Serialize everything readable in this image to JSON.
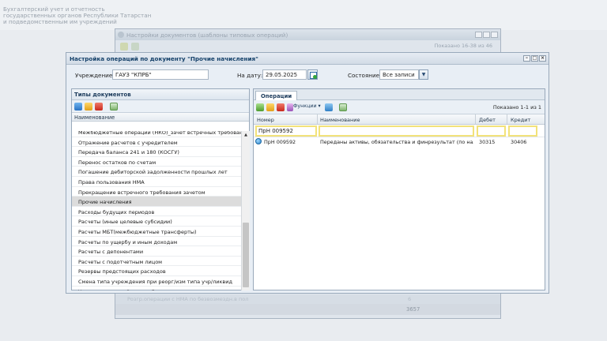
{
  "app": {
    "org_name": "Бухгалтерский учет и отчетность\nгосударственных органов Республики Татарстан\nи подведомственным им учреждений"
  },
  "background_window": {
    "title": "Настройки документов (шаблоны типовых операций)",
    "shown": "Показано 16-38 из 46",
    "footer_row_text": "Розгр.операции с НМА по безвозмездн.в пол",
    "footer_row_num": "6",
    "total": "3657"
  },
  "dialog": {
    "title": "Настройка операций по документу \"Прочие начисления\"",
    "institution_label": "Учреждение:",
    "institution_value": "ГАУЗ \"КПРБ\"",
    "date_label": "На дату:",
    "date_value": "29.05.2025",
    "state_label": "Состояние:",
    "state_value": "Все записи"
  },
  "left_panel": {
    "title": "Типы документов",
    "column_header": "Наименование",
    "items": [
      "Межбюджетные операции (НКО)_зачет встречных требований",
      "Отражение расчетов с учредителем",
      "Передача баланса 241 и 180 (КОСГУ)",
      "Перенос остатков по счетам",
      "Погашение дебиторской задолженности прошлых лет",
      "Права пользования НМА",
      "Прекращение встречного требования зачетом",
      "Прочие начисления",
      "Расходы будущих периодов",
      "Расчеты (иные целевые субсидии)",
      "Расчеты МБТ(межбюджетные трансферты)",
      "Расчеты по ущербу и иным доходам",
      "Расчеты с депонентами",
      "Расчеты с подотчетным лицом",
      "Резервы предстоящих расходов",
      "Смена типа учреждения при реорг/изм типа учр/ликвид",
      "Уменьшение расчётов с дебиторами по доходам"
    ],
    "selected_index": 7
  },
  "right_panel": {
    "tab": "Операции",
    "functions_label": "Функции",
    "shown": "Показано 1-1 из 1",
    "columns": {
      "number": "Номер",
      "name": "Наименование",
      "debit": "Дебет",
      "credit": "Кредит"
    },
    "filter_number": "ПрН 009592",
    "rows": [
      {
        "number": "ПрН 009592",
        "name": "Переданы активы, обязательства и финрезультат (по налог...",
        "debit": "30315",
        "credit": "30406"
      }
    ]
  },
  "colors": {
    "accent": "#15416a",
    "filter_border": "#f2e27a",
    "selected_row": "#dcdcdc"
  }
}
